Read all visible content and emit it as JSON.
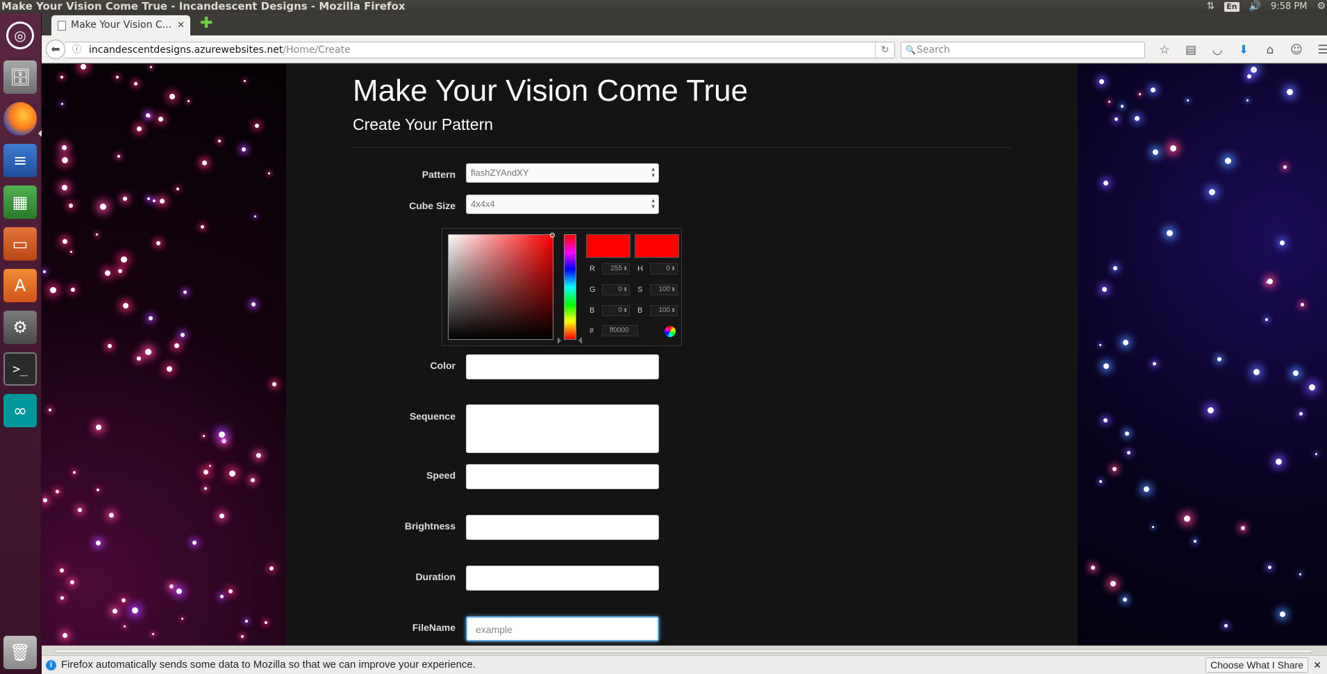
{
  "os": {
    "window_title": "Make Your Vision Come True - Incandescent Designs - Mozilla Firefox",
    "keyboard": "En",
    "clock": "9:58 PM"
  },
  "browser": {
    "tab_label": "Make Your Vision C...",
    "url_domain": "incandescentdesigns.azurewebsites.net",
    "url_path": "/Home/Create",
    "search_placeholder": "Search",
    "notification": "Firefox automatically sends some data to Mozilla so that we can improve your experience.",
    "notification_button": "Choose What I Share"
  },
  "page": {
    "title": "Make Your Vision Come True",
    "subtitle": "Create Your Pattern",
    "fields": {
      "pattern_label": "Pattern",
      "pattern_value": "flashZYAndXY",
      "cube_size_label": "Cube Size",
      "cube_size_value": "4x4x4",
      "color_label": "Color",
      "sequence_label": "Sequence",
      "speed_label": "Speed",
      "brightness_label": "Brightness",
      "duration_label": "Duration",
      "filename_label": "FileName",
      "filename_placeholder": "example"
    },
    "picker": {
      "r_label": "R",
      "r": "255",
      "g_label": "G",
      "g": "0",
      "b_label": "B",
      "b": "0",
      "h_label": "H",
      "h": "0",
      "s_label": "S",
      "s": "100",
      "v_label": "B",
      "v": "100",
      "hex_label": "#",
      "hex": "ff0000",
      "current_color": "#ff0000",
      "new_color": "#ff0000"
    }
  }
}
